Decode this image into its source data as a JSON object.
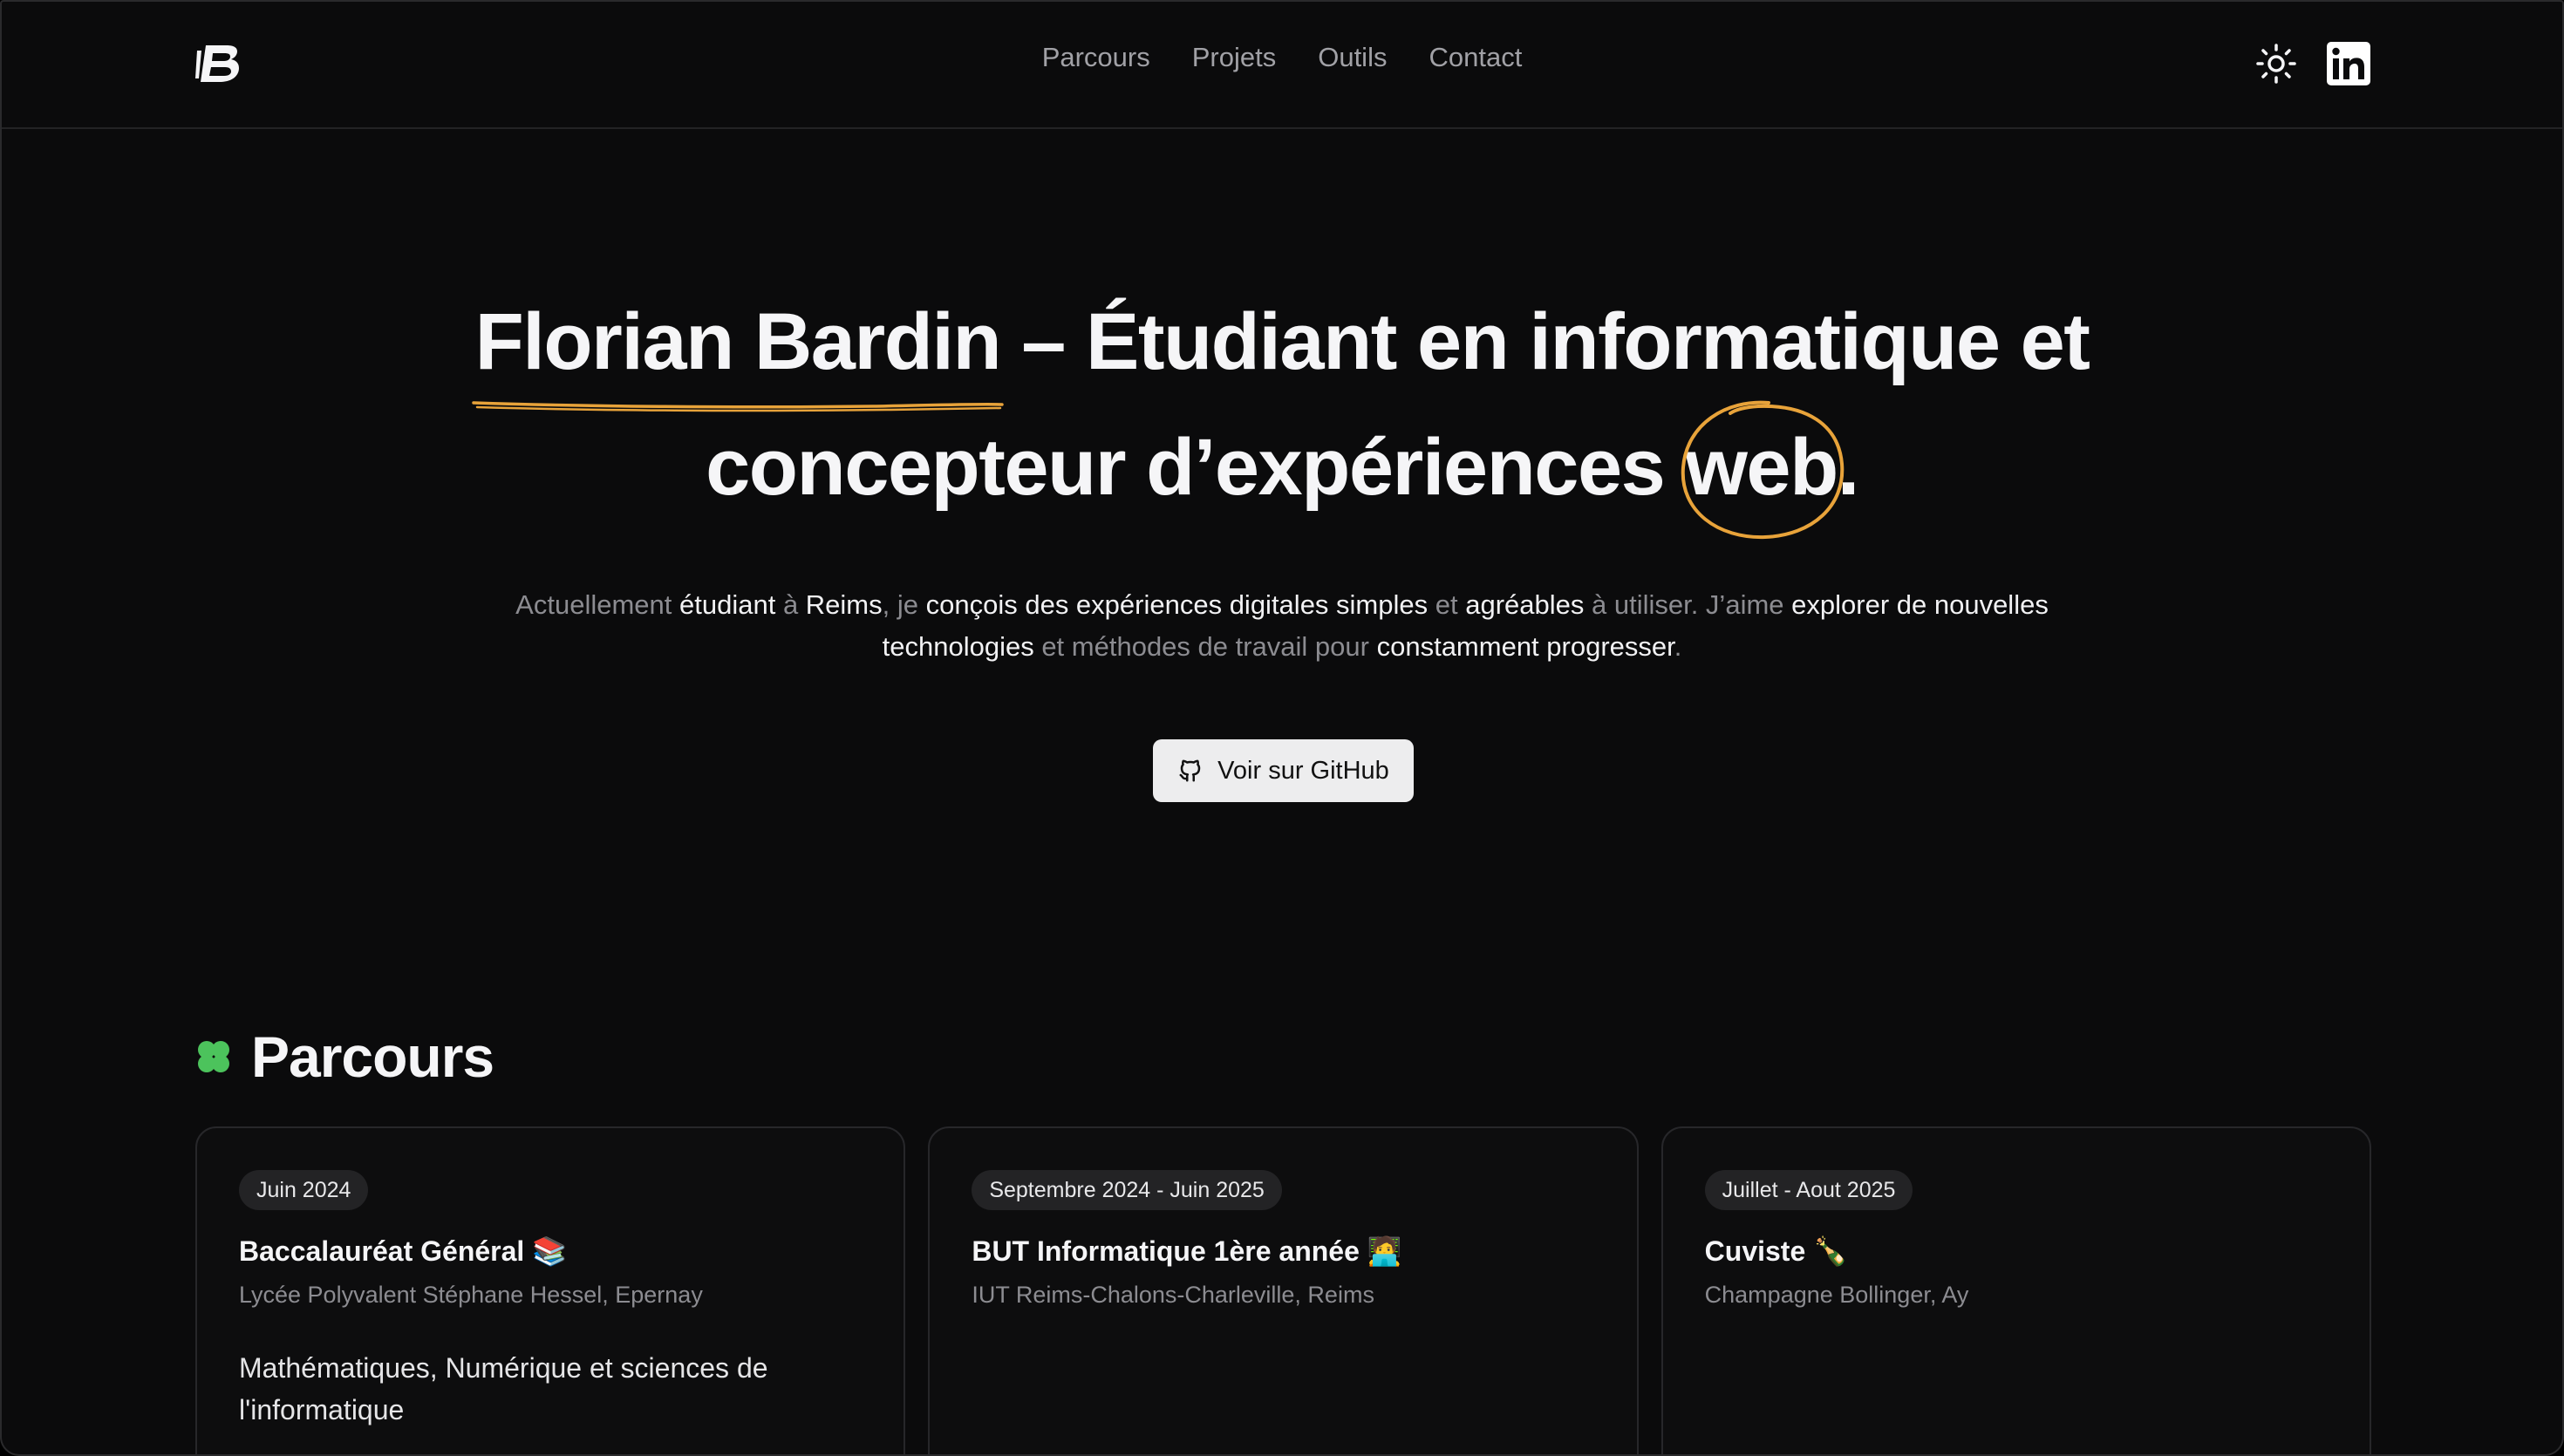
{
  "header": {
    "nav": [
      "Parcours",
      "Projets",
      "Outils",
      "Contact"
    ]
  },
  "hero": {
    "name": "Florian Bardin",
    "title_rest_line1": " – Étudiant en informatique et",
    "title_line2_start": "concepteur d’expériences ",
    "title_highlight": "web",
    "title_end": "."
  },
  "intro": {
    "segments": [
      {
        "t": "Actuellement ",
        "hl": false
      },
      {
        "t": "étudiant",
        "hl": true
      },
      {
        "t": " à ",
        "hl": false
      },
      {
        "t": "Reims",
        "hl": true
      },
      {
        "t": ", je ",
        "hl": false
      },
      {
        "t": "conçois des expériences digitales simples",
        "hl": true
      },
      {
        "t": " et ",
        "hl": false
      },
      {
        "t": "agréables",
        "hl": true
      },
      {
        "t": " à utiliser. J’aime ",
        "hl": false
      },
      {
        "t": "explorer de nouvelles technologies",
        "hl": true
      },
      {
        "t": " et méthodes de travail pour ",
        "hl": false
      },
      {
        "t": "constamment progresser",
        "hl": true
      },
      {
        "t": ".",
        "hl": false
      }
    ]
  },
  "github_button": {
    "label": "Voir sur GitHub"
  },
  "parcours": {
    "title": "Parcours",
    "cards": [
      {
        "date": "Juin 2024",
        "title": "Baccalauréat Général 📚",
        "place": "Lycée Polyvalent Stéphane Hessel, Epernay",
        "desc": "Mathématiques, Numérique et sciences de l'informatique"
      },
      {
        "date": "Septembre 2024 - Juin 2025",
        "title": "BUT Informatique 1ère année 🧑‍💻",
        "place": "IUT Reims-Chalons-Charleville, Reims",
        "desc": ""
      },
      {
        "date": "Juillet - Aout 2025",
        "title": "Cuviste 🍾",
        "place": "Champagne Bollinger, Ay",
        "desc": ""
      }
    ]
  },
  "colors": {
    "background": "#0b0b0c",
    "accent_orange": "#e8a33a",
    "clover_green": "#4cc35c",
    "text_primary": "#f5f5f7",
    "text_muted": "#8c8c91"
  },
  "icons": [
    "logo-icon",
    "sun-icon",
    "linkedin-icon",
    "github-icon",
    "clover-icon"
  ]
}
